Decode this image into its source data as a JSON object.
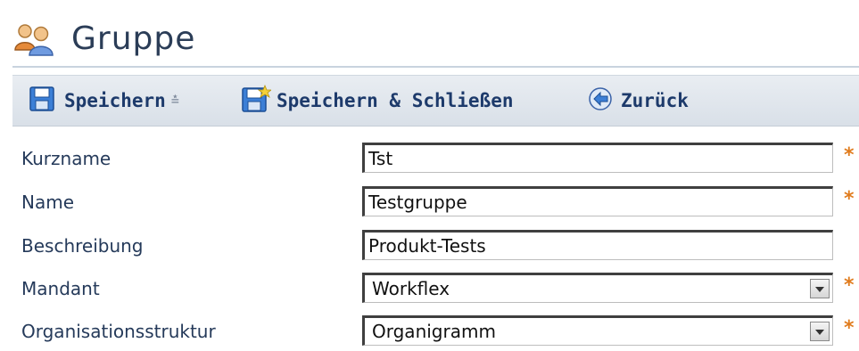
{
  "page": {
    "title": "Gruppe",
    "title_icon": "users-group-icon"
  },
  "toolbar": {
    "save_label": "Speichern",
    "save_icon": "floppy-disk-icon",
    "save_dropdown_icon": "double-chevron-down-icon",
    "save_close_label": "Speichern & Schließen",
    "save_close_icon": "floppy-disk-star-icon",
    "back_label": "Zurück",
    "back_icon": "back-arrow-icon"
  },
  "form": {
    "kurzname": {
      "label": "Kurzname",
      "value": "Tst",
      "required": true
    },
    "name": {
      "label": "Name",
      "value": "Testgruppe",
      "required": true
    },
    "beschreibung": {
      "label": "Beschreibung",
      "value": "Produkt-Tests",
      "required": false
    },
    "mandant": {
      "label": "Mandant",
      "value": "Workflex",
      "required": true
    },
    "organisationsstruktur": {
      "label": "Organisationsstruktur",
      "value": "Organigramm",
      "required": true
    },
    "required_marker": "*"
  },
  "colors": {
    "required": "#e07c1e",
    "label_text": "#253a5a",
    "toolbar_text": "#1d3a6b"
  }
}
